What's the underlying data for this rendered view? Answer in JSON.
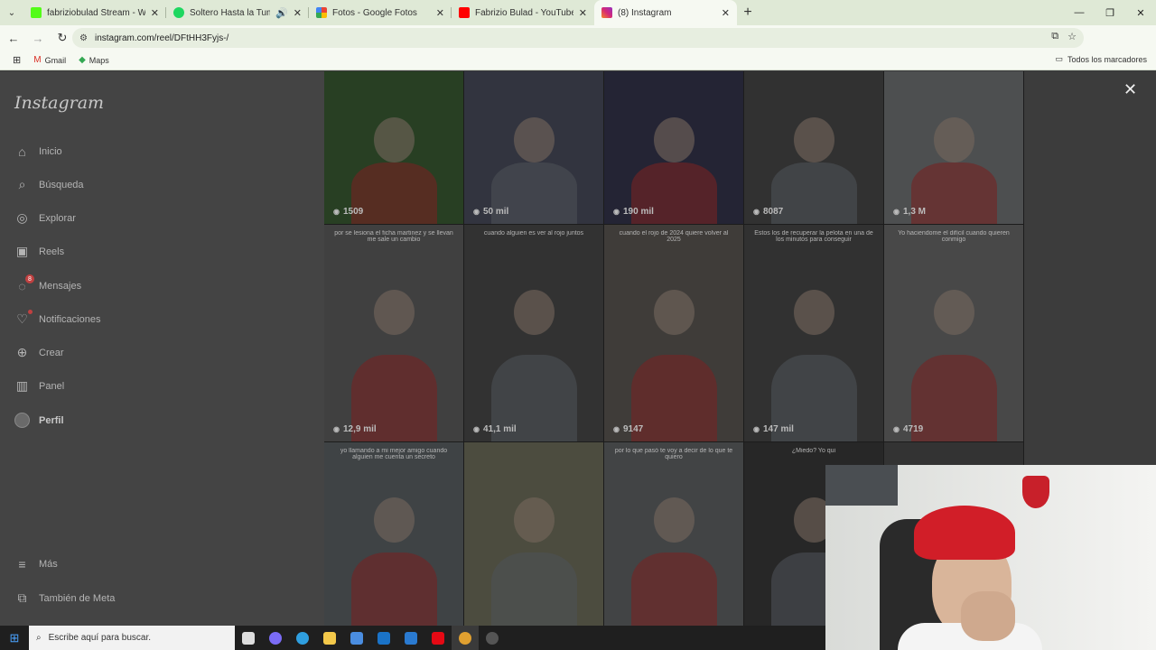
{
  "browser": {
    "tabs": [
      {
        "title": "fabriziobulad Stream - Watch L",
        "favicon_color": "#53fc18",
        "active": false
      },
      {
        "title": "Soltero Hasta la Tumba • El",
        "favicon_color": "#1ed760",
        "active": false,
        "audio": true
      },
      {
        "title": "Fotos - Google Fotos",
        "favicon_color": "#ea4335",
        "active": false
      },
      {
        "title": "Fabrizio Bulad - YouTube",
        "favicon_color": "#ff0000",
        "active": false
      },
      {
        "title": "(8) Instagram",
        "favicon_color": "#d62976",
        "active": true
      }
    ],
    "url": "instagram.com/reel/DFtHH3Fyjs-/",
    "bookmarks": [
      {
        "label": "Gmail",
        "icon": "gmail-icon"
      },
      {
        "label": "Maps",
        "icon": "maps-icon"
      }
    ],
    "all_bookmarks_label": "Todos los marcadores"
  },
  "instagram": {
    "logo": "Instagram",
    "nav": [
      {
        "label": "Inicio",
        "icon": "home-icon"
      },
      {
        "label": "Búsqueda",
        "icon": "search-icon"
      },
      {
        "label": "Explorar",
        "icon": "compass-icon"
      },
      {
        "label": "Reels",
        "icon": "reels-icon"
      },
      {
        "label": "Mensajes",
        "icon": "messenger-icon",
        "badge": "8"
      },
      {
        "label": "Notificaciones",
        "icon": "heart-icon",
        "dot": true
      },
      {
        "label": "Crear",
        "icon": "plus-square-icon"
      },
      {
        "label": "Panel",
        "icon": "chart-icon"
      },
      {
        "label": "Perfil",
        "icon": "profile-avatar"
      }
    ],
    "more": [
      {
        "label": "Más",
        "icon": "menu-icon"
      },
      {
        "label": "También de Meta",
        "icon": "meta-icon"
      }
    ]
  },
  "grid": {
    "rows": [
      [
        {
          "views": "1509",
          "caption": "",
          "bg": "#2f4a2a"
        },
        {
          "views": "50 mil",
          "caption": "",
          "bg": "#3b3e4a"
        },
        {
          "views": "190 mil",
          "caption": "",
          "bg": "#2b2b3e"
        },
        {
          "views": "8087",
          "caption": "",
          "bg": "#3a3a3a"
        },
        {
          "views": "1,3 M",
          "caption": "",
          "bg": "#5b5d5e"
        }
      ],
      [
        {
          "views": "12,9 mil",
          "caption": "por se lesiona el ficha martinez y se llevan me sale un cambio",
          "bg": "#4c4c4c"
        },
        {
          "views": "41,1 mil",
          "caption": "cuando alguien es ver al rojo juntos",
          "bg": "#3b3b3b"
        },
        {
          "views": "9147",
          "caption": "cuando el rojo de 2024 quiere volver al 2025",
          "bg": "#4a4744"
        },
        {
          "views": "147 mil",
          "caption": "Estos los de recuperar la pelota en una de los minutos para conseguir",
          "bg": "#3a3a3a"
        },
        {
          "views": "4719",
          "caption": "Yo haciendome el difícil cuando quieren conmigo",
          "bg": "#555"
        }
      ],
      [
        {
          "views": "",
          "caption": "yo llamando a mi mejor amigo cuando alguien me cuenta un secreto",
          "bg": "#4a4f52"
        },
        {
          "views": "",
          "caption": "",
          "bg": "#5a5a4a"
        },
        {
          "views": "",
          "caption": "por lo que pasó te voy a decir de lo que te quiero",
          "bg": "#4e5052"
        },
        {
          "views": "",
          "caption": "¿Miedo? Yo qui",
          "bg": "#2e2e2e"
        },
        {
          "views": "",
          "caption": "",
          "bg": "#3c3c3c"
        }
      ]
    ]
  },
  "taskbar": {
    "search_placeholder": "Escribe aquí para buscar.",
    "apps": [
      {
        "name": "task-view-icon",
        "color": "#dddddd"
      },
      {
        "name": "copilot-icon",
        "color": "#7b6cf6"
      },
      {
        "name": "edge-icon",
        "color": "#2f9fe0"
      },
      {
        "name": "file-explorer-icon",
        "color": "#f3c84a"
      },
      {
        "name": "store-icon",
        "color": "#4a8de0"
      },
      {
        "name": "outlook-icon",
        "color": "#1a73c8"
      },
      {
        "name": "photos-icon",
        "color": "#2a7ad0"
      },
      {
        "name": "netflix-icon",
        "color": "#e50914"
      },
      {
        "name": "chrome-icon",
        "color": "#e0a030"
      },
      {
        "name": "obs-icon",
        "color": "#555555"
      }
    ]
  }
}
